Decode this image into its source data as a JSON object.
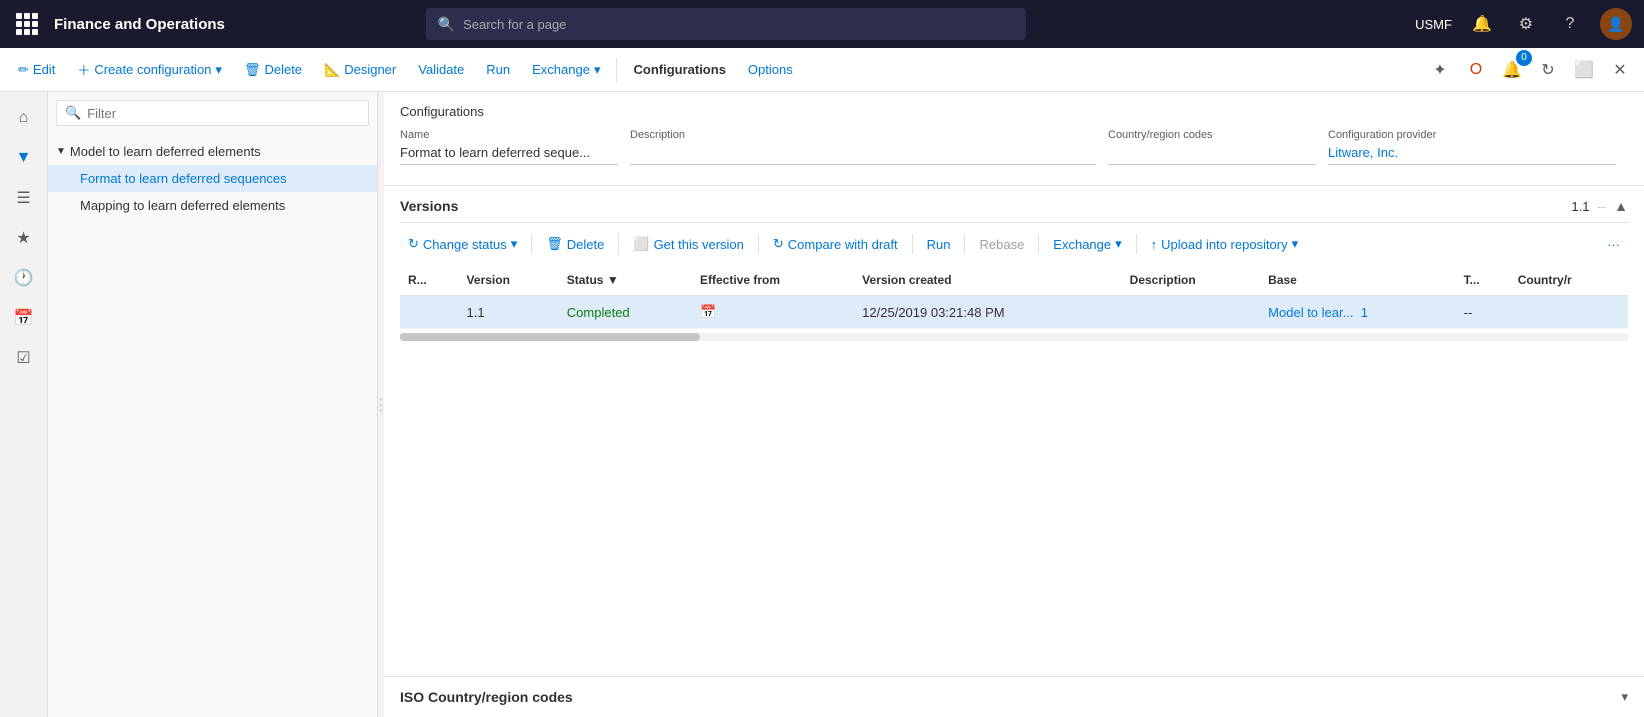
{
  "app": {
    "title": "Finance and Operations"
  },
  "search": {
    "placeholder": "Search for a page"
  },
  "topnav": {
    "username": "USMF"
  },
  "cmdbar": {
    "edit_label": "Edit",
    "create_label": "Create configuration",
    "delete_label": "Delete",
    "designer_label": "Designer",
    "validate_label": "Validate",
    "run_label": "Run",
    "exchange_label": "Exchange",
    "configurations_label": "Configurations",
    "options_label": "Options"
  },
  "tree": {
    "filter_placeholder": "Filter",
    "parent_item": "Model to learn deferred elements",
    "items": [
      {
        "label": "Format to learn deferred sequences",
        "selected": true
      },
      {
        "label": "Mapping to learn deferred elements",
        "selected": false
      }
    ]
  },
  "configurations": {
    "section_title": "Configurations",
    "fields": {
      "name_label": "Name",
      "name_value": "Format to learn deferred seque...",
      "description_label": "Description",
      "description_value": "",
      "country_label": "Country/region codes",
      "country_value": "",
      "provider_label": "Configuration provider",
      "provider_value": "Litware, Inc."
    }
  },
  "versions": {
    "title": "Versions",
    "version_num": "1.1",
    "separator": "--",
    "toolbar": {
      "change_status": "Change status",
      "delete": "Delete",
      "get_this_version": "Get this version",
      "compare_with_draft": "Compare with draft",
      "run": "Run",
      "rebase": "Rebase",
      "exchange": "Exchange",
      "upload_into_repository": "Upload into repository"
    },
    "table": {
      "columns": [
        "R...",
        "Version",
        "Status",
        "Effective from",
        "Version created",
        "Description",
        "Base",
        "T...",
        "Country/r"
      ],
      "rows": [
        {
          "r": "",
          "version": "1.1",
          "status": "Completed",
          "effective_from": "",
          "version_created": "12/25/2019 03:21:48 PM",
          "description": "",
          "base": "Model to lear...",
          "base_num": "1",
          "t": "--",
          "country": "",
          "selected": true
        }
      ]
    }
  },
  "iso": {
    "title": "ISO Country/region codes"
  }
}
